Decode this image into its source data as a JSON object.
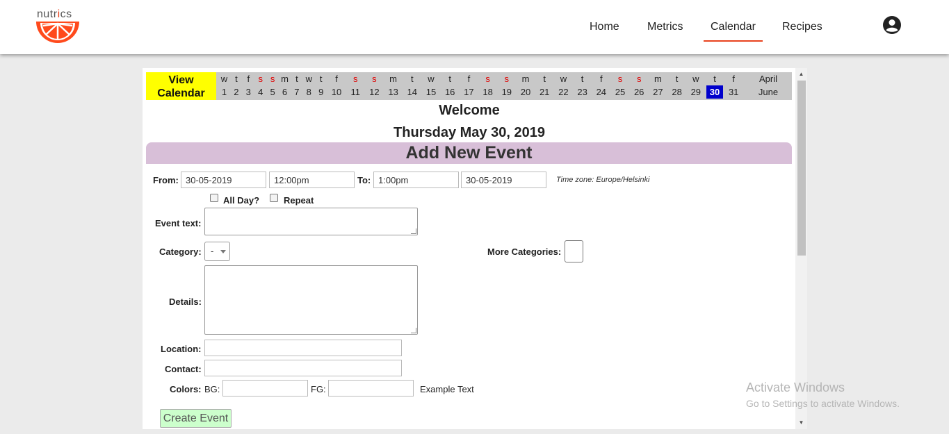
{
  "logo": {
    "text_before": "nutr",
    "text_drop": "i",
    "text_after": "cs"
  },
  "nav": {
    "home": "Home",
    "metrics": "Metrics",
    "calendar": "Calendar",
    "recipes": "Recipes",
    "account_icon": "account-circle-icon"
  },
  "calendar_strip": {
    "view_label": "View Calendar",
    "weekdays": [
      "w",
      "t",
      "f",
      "s",
      "s",
      "m",
      "t",
      "w",
      "t",
      "f",
      "s",
      "s",
      "m",
      "t",
      "w",
      "t",
      "f",
      "s",
      "s",
      "m",
      "t",
      "w",
      "t",
      "f",
      "s",
      "s",
      "m",
      "t",
      "w",
      "t",
      "f"
    ],
    "days": [
      "1",
      "2",
      "3",
      "4",
      "5",
      "6",
      "7",
      "8",
      "9",
      "10",
      "11",
      "12",
      "13",
      "14",
      "15",
      "16",
      "17",
      "18",
      "19",
      "20",
      "21",
      "22",
      "23",
      "24",
      "25",
      "26",
      "27",
      "28",
      "29",
      "30",
      "31"
    ],
    "weekend_indices": [
      3,
      4,
      10,
      11,
      17,
      18,
      24,
      25
    ],
    "today_index": 29,
    "prev_month": "April",
    "next_month": "June",
    "weekend_color": "#e00000",
    "today_color": "#0000cc"
  },
  "welcome": "Welcome",
  "date_line": "Thursday May 30, 2019",
  "form": {
    "header": "Add New Event",
    "from_label": "From:",
    "from_date": "30-05-2019",
    "from_time": "12:00pm",
    "to_label": "To:",
    "to_time": "1:00pm",
    "to_date": "30-05-2019",
    "timezone": "Time zone: Europe/Helsinki",
    "all_day_label": "All Day?",
    "repeat_label": "Repeat",
    "event_text_label": "Event text:",
    "category_label": "Category:",
    "category_value": "-",
    "more_categories_label": "More Categories:",
    "details_label": "Details:",
    "location_label": "Location:",
    "contact_label": "Contact:",
    "colors_label": "Colors:",
    "bg_label": "BG:",
    "fg_label": "FG:",
    "example_text": "Example Text",
    "create_button": "Create Event",
    "header_color": "#d8bfd8",
    "button_color": "#ccffcc"
  },
  "watermark": {
    "line1": "Activate Windows",
    "line2": "Go to Settings to activate Windows."
  }
}
